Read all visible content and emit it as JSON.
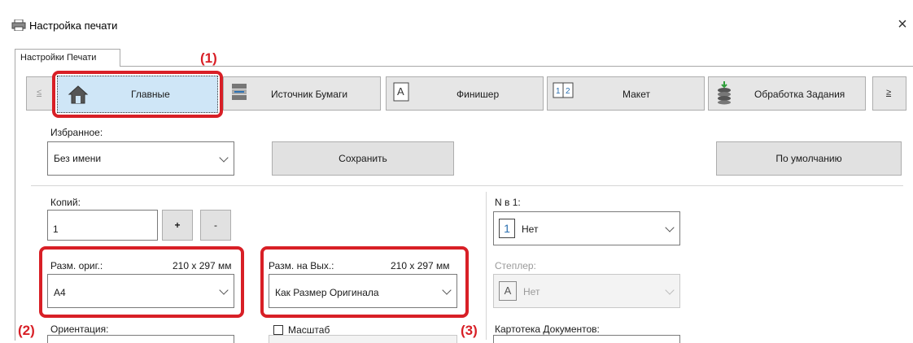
{
  "window": {
    "title": "Настройка печати",
    "close_glyph": "×"
  },
  "tab": {
    "label": "Настройки Печати"
  },
  "nav": {
    "prev": "≤",
    "next": "≥",
    "items": [
      {
        "label": "Главные",
        "icon": "house-icon"
      },
      {
        "label": "Источник Бумаги",
        "icon": "paper-tray-icon"
      },
      {
        "label": "Финишер",
        "icon": "finisher-a-icon"
      },
      {
        "label": "Макет",
        "icon": "layout-12-icon"
      },
      {
        "label": "Обработка Задания",
        "icon": "job-stack-icon"
      }
    ]
  },
  "favorites": {
    "label": "Избранное:",
    "value": "Без имени",
    "save": "Сохранить",
    "default": "По умолчанию"
  },
  "copies": {
    "label": "Копий:",
    "value": "1",
    "plus": "+",
    "minus": "-"
  },
  "orig_size": {
    "label": "Разм. ориг.:",
    "dims": "210 x 297 мм",
    "value": "A4"
  },
  "out_size": {
    "label": "Разм. на Вых.:",
    "dims": "210 x 297 мм",
    "value": "Как Размер Оригинала"
  },
  "n_up": {
    "label": "N в 1:",
    "badge": "1",
    "value": "Нет"
  },
  "stapler": {
    "label": "Степлер:",
    "badge": "A",
    "value": "Нет"
  },
  "orientation": {
    "label": "Ориентация:"
  },
  "zoom": {
    "label": "Масштаб"
  },
  "doc_filing": {
    "label": "Картотека Документов:"
  },
  "callouts": {
    "c1": "(1)",
    "c2": "(2)",
    "c3": "(3)"
  },
  "colors": {
    "callout": "#d81f26",
    "selected_tab": "#cfe6f7"
  }
}
